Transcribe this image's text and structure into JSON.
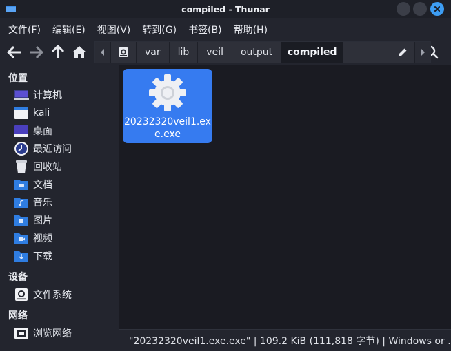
{
  "window": {
    "title": "compiled - Thunar"
  },
  "menubar": {
    "items": [
      {
        "label": "文件(F)"
      },
      {
        "label": "编辑(E)"
      },
      {
        "label": "视图(V)"
      },
      {
        "label": "转到(G)"
      },
      {
        "label": "书签(B)"
      },
      {
        "label": "帮助(H)"
      }
    ]
  },
  "pathbar": {
    "crumbs": [
      "var",
      "lib",
      "veil",
      "output",
      "compiled"
    ],
    "active": "compiled"
  },
  "sidebar": {
    "places_header": "位置",
    "places": [
      {
        "label": "计算机",
        "icon": "computer-icon"
      },
      {
        "label": "kali",
        "icon": "home-folder-icon"
      },
      {
        "label": "桌面",
        "icon": "desktop-folder-icon"
      },
      {
        "label": "最近访问",
        "icon": "recent-icon"
      },
      {
        "label": "回收站",
        "icon": "trash-icon"
      },
      {
        "label": "文档",
        "icon": "documents-folder-icon"
      },
      {
        "label": "音乐",
        "icon": "music-folder-icon"
      },
      {
        "label": "图片",
        "icon": "pictures-folder-icon"
      },
      {
        "label": "视频",
        "icon": "videos-folder-icon"
      },
      {
        "label": "下载",
        "icon": "downloads-folder-icon"
      }
    ],
    "devices_header": "设备",
    "devices": [
      {
        "label": "文件系统",
        "icon": "filesystem-icon"
      }
    ],
    "network_header": "网络",
    "network": [
      {
        "label": "浏览网络",
        "icon": "network-icon"
      }
    ]
  },
  "files": [
    {
      "name": "20232320veil1.exe.exe",
      "icon": "executable-gear-icon",
      "selected": true
    }
  ],
  "statusbar": {
    "text": "\"20232320veil1.exe.exe\" | 109.2 KiB (111,818 字节) | Windows or …"
  },
  "colors": {
    "accent": "#367bf0",
    "background": "#23252e",
    "content_bg": "#1a1b22"
  }
}
